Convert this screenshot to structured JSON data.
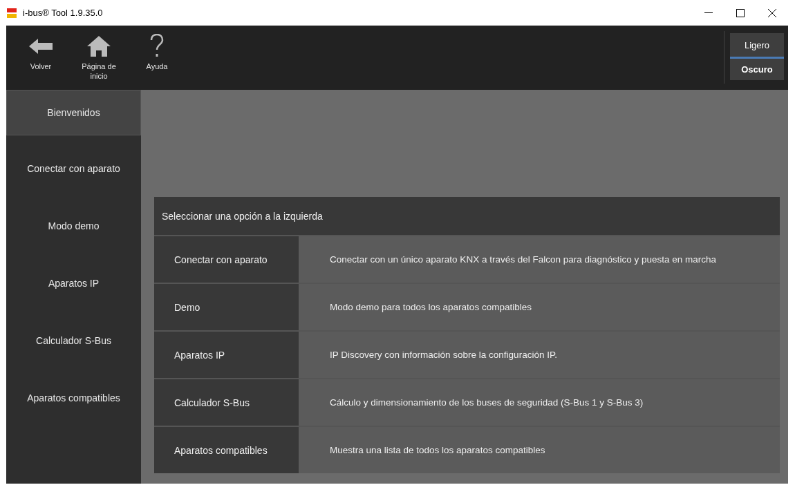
{
  "window": {
    "title": "i-bus® Tool 1.9.35.0"
  },
  "toolbar": {
    "buttons": [
      {
        "kind": "back",
        "label": "Volver"
      },
      {
        "kind": "home",
        "label": "Página de inicio"
      },
      {
        "kind": "help",
        "label": "Ayuda"
      }
    ]
  },
  "theme": [
    {
      "label": "Ligero",
      "selected": false
    },
    {
      "label": "Oscuro",
      "selected": true
    }
  ],
  "sidebar": {
    "items": [
      {
        "label": "Bienvenidos",
        "selected": true
      },
      {
        "label": "Conectar con aparato",
        "selected": false
      },
      {
        "label": "Modo demo",
        "selected": false
      },
      {
        "label": "Aparatos IP",
        "selected": false
      },
      {
        "label": "Calculador S-Bus",
        "selected": false
      },
      {
        "label": "Aparatos compatibles",
        "selected": false
      }
    ]
  },
  "panel": {
    "heading": "Seleccionar una opción a la izquierda",
    "rows": [
      {
        "option": "Conectar con aparato",
        "description": "Conectar con un único aparato KNX a través del Falcon para diagnóstico y puesta en marcha"
      },
      {
        "option": "Demo",
        "description": "Modo demo para todos los aparatos compatibles"
      },
      {
        "option": "Aparatos IP",
        "description": "IP Discovery con información sobre la configuración IP."
      },
      {
        "option": "Calculador S-Bus",
        "description": "Cálculo y dimensionamiento de los buses de seguridad (S-Bus 1 y S-Bus 3)"
      },
      {
        "option": "Aparatos compatibles",
        "description": "Muestra una lista de todos los aparatos compatibles"
      }
    ]
  }
}
